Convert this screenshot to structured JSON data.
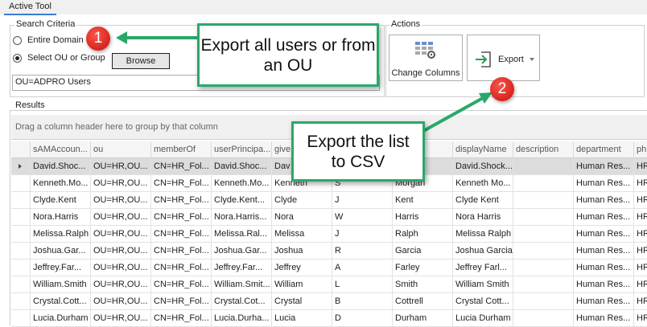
{
  "tab": {
    "label": "Active Tool"
  },
  "search": {
    "legend": "Search Criteria",
    "option_domain": "Entire Domain",
    "option_ou": "Select OU or Group",
    "browse_label": "Browse",
    "ou_value": "OU=ADPRO Users"
  },
  "actions": {
    "legend": "Actions",
    "change_columns_label": "Change Columns",
    "export_label": "Export"
  },
  "results": {
    "legend": "Results",
    "group_hint": "Drag a column header here to group by that column",
    "columns": [
      "sAMAccoun...",
      "ou",
      "memberOf",
      "userPrincipa...",
      "give",
      "",
      "",
      "displayName",
      "description",
      "department",
      "ph"
    ],
    "rows": [
      [
        "David.Shoc...",
        "OU=HR,OU...",
        "CN=HR_Fol...",
        "David.Shoc...",
        "Dav",
        "",
        "",
        "David.Shock...",
        "",
        "Human Res...",
        "HR"
      ],
      [
        "Kenneth.Mo...",
        "OU=HR,OU...",
        "CN=HR_Fol...",
        "Kenneth.Mo...",
        "Kenneth",
        "S",
        "Morgan",
        "Kenneth Mo...",
        "",
        "Human Res...",
        "HR"
      ],
      [
        "Clyde.Kent",
        "OU=HR,OU...",
        "CN=HR_Fol...",
        "Clyde.Kent...",
        "Clyde",
        "J",
        "Kent",
        "Clyde Kent",
        "",
        "Human Res...",
        "HR"
      ],
      [
        "Nora.Harris",
        "OU=HR,OU...",
        "CN=HR_Fol...",
        "Nora.Harris...",
        "Nora",
        "W",
        "Harris",
        "Nora Harris",
        "",
        "Human Res...",
        "HR"
      ],
      [
        "Melissa.Ralph",
        "OU=HR,OU...",
        "CN=HR_Fol...",
        "Melissa.Ral...",
        "Melissa",
        "J",
        "Ralph",
        "Melissa Ralph",
        "",
        "Human Res...",
        "HR"
      ],
      [
        "Joshua.Gar...",
        "OU=HR,OU...",
        "CN=HR_Fol...",
        "Joshua.Gar...",
        "Joshua",
        "R",
        "Garcia",
        "Joshua Garcia",
        "",
        "Human Res...",
        "HR"
      ],
      [
        "Jeffrey.Far...",
        "OU=HR,OU...",
        "CN=HR_Fol...",
        "Jeffrey.Far...",
        "Jeffrey",
        "A",
        "Farley",
        "Jeffrey Farl...",
        "",
        "Human Res...",
        "HR"
      ],
      [
        "William.Smith",
        "OU=HR,OU...",
        "CN=HR_Fol...",
        "William.Smit...",
        "William",
        "L",
        "Smith",
        "William Smith",
        "",
        "Human Res...",
        "HR"
      ],
      [
        "Crystal.Cott...",
        "OU=HR,OU...",
        "CN=HR_Fol...",
        "Crystal.Cot...",
        "Crystal",
        "B",
        "Cottrell",
        "Crystal Cott...",
        "",
        "Human Res...",
        "HR"
      ],
      [
        "Lucia.Durham",
        "OU=HR,OU...",
        "CN=HR_Fol...",
        "Lucia.Durha...",
        "Lucia",
        "D",
        "Durham",
        "Lucia Durham",
        "",
        "Human Res...",
        "HR"
      ]
    ]
  },
  "callouts": {
    "one_text": "Export all users or from an OU",
    "two_text": "Export the list to CSV",
    "badge_one": "1",
    "badge_two": "2"
  },
  "colors": {
    "accent_green": "#2aa86a",
    "badge_red": "#e0302a",
    "selected_row": "#dcdcdc"
  },
  "icons": {
    "change_columns": "columns-grid-gear-icon",
    "export": "export-arrow-icon",
    "dropdown": "chevron-down-icon",
    "row_pointer": "row-pointer-icon"
  }
}
